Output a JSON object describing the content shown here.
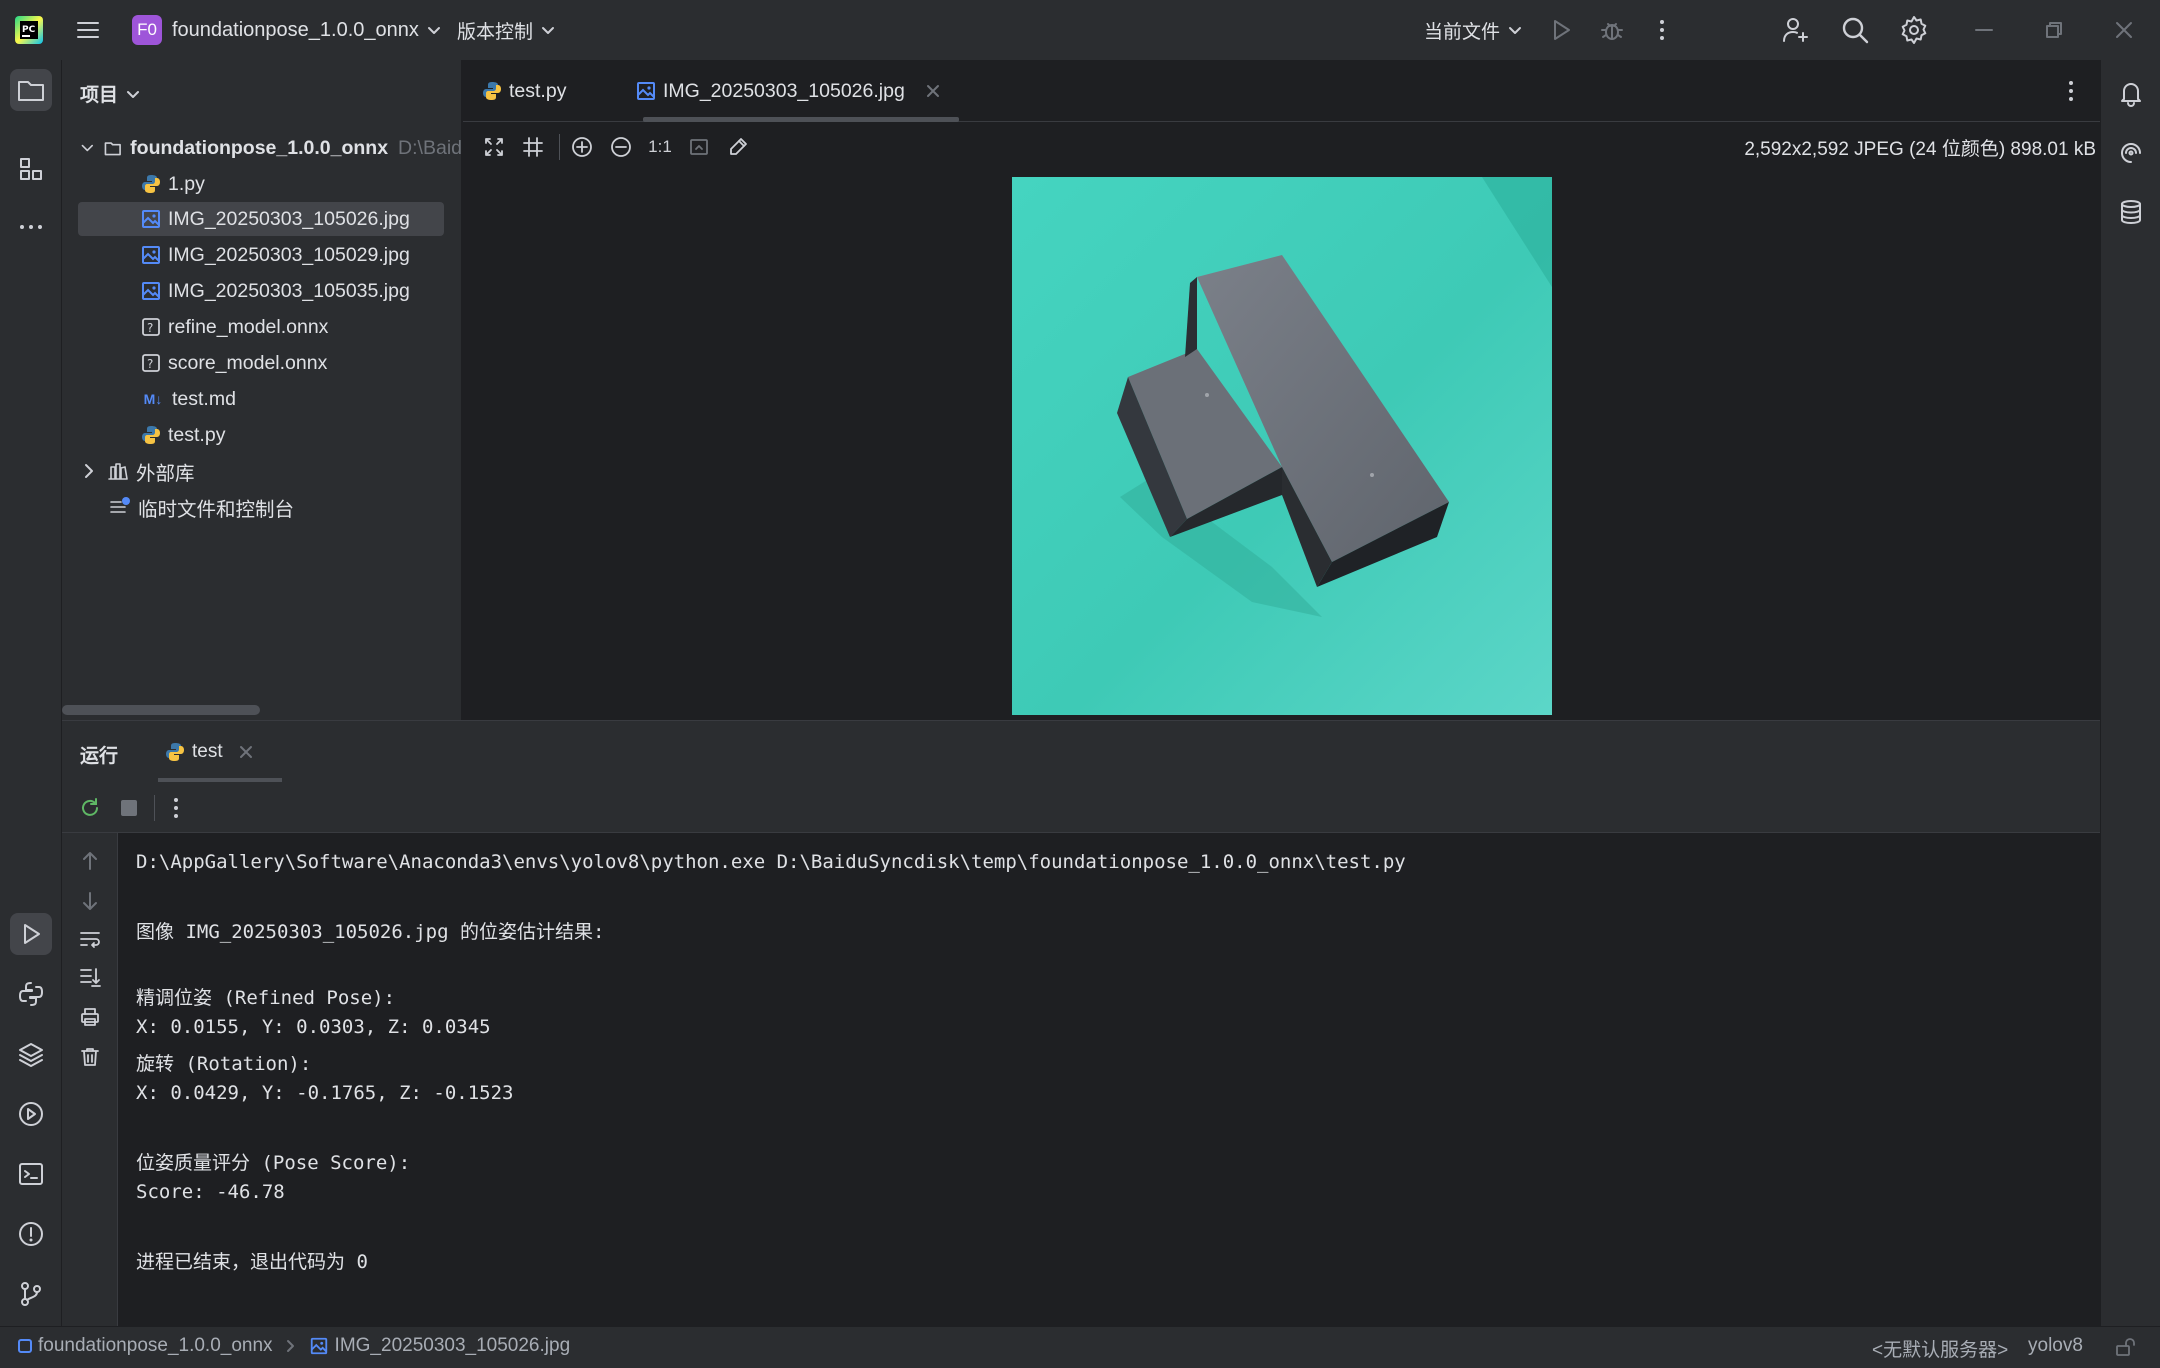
{
  "titlebar": {
    "project_badge": "F0",
    "project_name": "foundationpose_1.0.0_onnx",
    "vcs_label": "版本控制",
    "run_config": "当前文件",
    "icons": [
      "pycharm-logo-icon",
      "hamburger-menu-icon",
      "run-icon",
      "debug-icon",
      "more-vertical-icon",
      "add-user-icon",
      "search-icon",
      "settings-icon",
      "minimize-icon",
      "restore-icon",
      "close-icon"
    ]
  },
  "project_panel": {
    "header": "项目",
    "root_name": "foundationpose_1.0.0_onnx",
    "root_path": "D:\\Baid",
    "items": [
      {
        "label": "1.py",
        "icon": "python-icon"
      },
      {
        "label": "IMG_20250303_105026.jpg",
        "icon": "image-icon",
        "selected": true
      },
      {
        "label": "IMG_20250303_105029.jpg",
        "icon": "image-icon"
      },
      {
        "label": "IMG_20250303_105035.jpg",
        "icon": "image-icon"
      },
      {
        "label": "refine_model.onnx",
        "icon": "unknown-file-icon"
      },
      {
        "label": "score_model.onnx",
        "icon": "unknown-file-icon"
      },
      {
        "label": "test.md",
        "icon": "markdown-icon",
        "icon_text": "M↓"
      },
      {
        "label": "test.py",
        "icon": "python-icon"
      }
    ],
    "external_libs": "外部库",
    "scratches": "临时文件和控制台"
  },
  "editor": {
    "tabs": [
      {
        "label": "test.py",
        "icon": "python-icon",
        "active": false
      },
      {
        "label": "IMG_20250303_105026.jpg",
        "icon": "image-icon",
        "active": true
      }
    ],
    "zoom_actual_label": "1:1",
    "image_info": "2,592x2,592 JPEG (24 位颜色) 898.01 kB"
  },
  "run_panel": {
    "title": "运行",
    "tab_label": "test",
    "console_lines": [
      "D:\\AppGallery\\Software\\Anaconda3\\envs\\yolov8\\python.exe D:\\BaiduSyncdisk\\temp\\foundationpose_1.0.0_onnx\\test.py",
      "",
      "图像 IMG_20250303_105026.jpg 的位姿估计结果:",
      "",
      "精调位姿 (Refined Pose):",
      "X: 0.0155, Y: 0.0303, Z: 0.0345",
      "旋转 (Rotation):",
      "X: 0.0429, Y: -0.1765, Z: -0.1523",
      "",
      "位姿质量评分 (Pose Score):",
      "Score: -46.78",
      "",
      "进程已结束，退出代码为 0"
    ]
  },
  "statusbar": {
    "crumb_project": "foundationpose_1.0.0_onnx",
    "crumb_file": "IMG_20250303_105026.jpg",
    "server": "<无默认服务器>",
    "interpreter": "yolov8"
  },
  "colors": {
    "bg_dark": "#1e1f22",
    "bg_panel": "#2b2d30",
    "accent": "#3574f0",
    "badge": "#9e55d9",
    "photo_bg": "#3fcfb8"
  }
}
